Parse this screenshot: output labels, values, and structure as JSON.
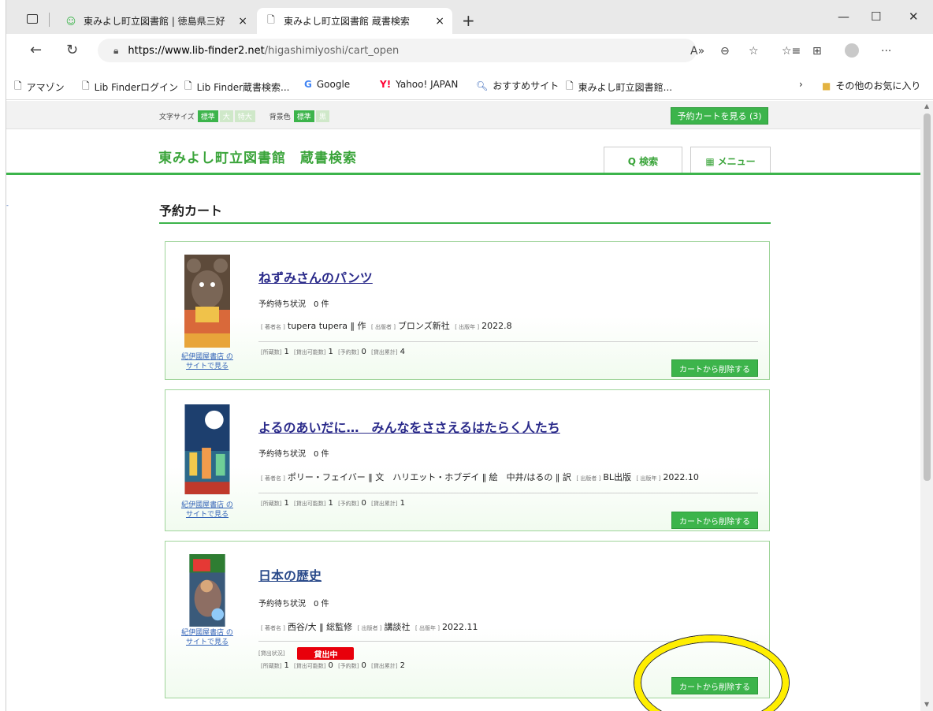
{
  "browser": {
    "tabs": [
      {
        "title": "東みよし町立図書館 | 徳島県三好",
        "close": "×"
      },
      {
        "title": "東みよし町立図書館  蔵書検索",
        "close": "×"
      }
    ],
    "new_tab": "+",
    "window_controls": {
      "minimize": "—",
      "maximize": "☐",
      "close": "✕"
    },
    "url_domain": "https://www.lib-finder2.net",
    "url_path": "/higashimiyoshi/cart_open",
    "more": "···",
    "bookmarks": [
      {
        "label": "アマゾン"
      },
      {
        "label": "Lib Finderログイン"
      },
      {
        "label": "Lib Finder蔵書検索..."
      },
      {
        "label": "Google"
      },
      {
        "label": "Yahoo! JAPAN"
      },
      {
        "label": "おすすめサイト"
      },
      {
        "label": "東みよし町立図書館..."
      }
    ],
    "bookmarks_more": "›",
    "other_favorites": "その他のお気に入り"
  },
  "topbar": {
    "font_size_label": "文字サイズ",
    "font_sizes": [
      "標準",
      "大",
      "特大"
    ],
    "bg_label": "背景色",
    "bg_options": [
      "標準",
      "黒"
    ],
    "cart_button": "予約カートを見る (3)"
  },
  "header": {
    "site_title": "東みよし町立図書館　蔵書検索",
    "search_button": "Q 検索",
    "menu_button": "メニュー"
  },
  "page_title": "予約カート",
  "labels": {
    "wait_prefix": "予約待ち状況",
    "author": "[ 著者名 ]",
    "publisher": "[ 出版者 ]",
    "year": "[ 出版年 ]",
    "holdings": "[所蔵数]",
    "available": "[貸出可能数]",
    "reservations": "[予約数]",
    "total_loans": "[貸出累計]",
    "lend_status": "[貸出状況]",
    "shop_link_line1": "紀伊國屋書店 の",
    "shop_link_line2": "サイトで見る",
    "delete_button": "カートから削除する"
  },
  "items": [
    {
      "title": "ねずみさんのパンツ",
      "wait": "0 件",
      "author": "tupera tupera ‖ 作",
      "publisher": "ブロンズ新社",
      "year": "2022.8",
      "holdings": "1",
      "available": "1",
      "reservations": "0",
      "total_loans": "4",
      "lend_status": ""
    },
    {
      "title": "よるのあいだに…　みんなをささえるはたらく人たち",
      "wait": "0 件",
      "author": "ポリー・フェイバー ‖ 文　ハリエット・ホブデイ ‖ 絵　中井/はるの ‖ 訳",
      "publisher": "BL出版",
      "year": "2022.10",
      "holdings": "1",
      "available": "1",
      "reservations": "0",
      "total_loans": "1",
      "lend_status": ""
    },
    {
      "title": "日本の歴史",
      "wait": "0 件",
      "author": "西谷/大 ‖ 総監修",
      "publisher": "講談社",
      "year": "2022.11",
      "holdings": "1",
      "available": "0",
      "reservations": "0",
      "total_loans": "2",
      "lend_status": "貸出中"
    }
  ],
  "colors": {
    "accent": "#3cb44b",
    "lend_badge": "#e8000b",
    "highlight": "#ffee00"
  }
}
